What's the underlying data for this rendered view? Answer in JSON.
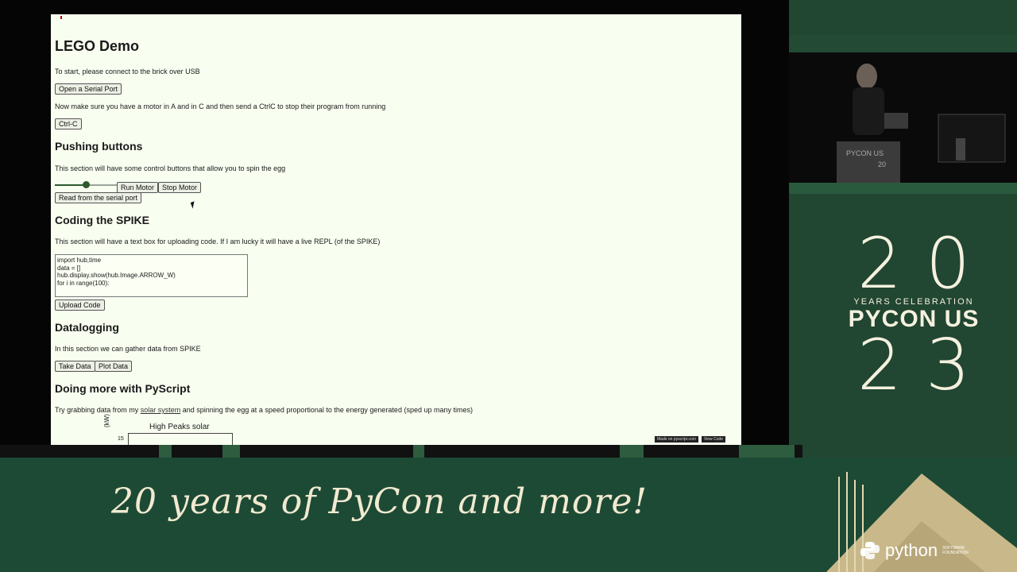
{
  "page": {
    "title": "LEGO Demo",
    "intro": "To start, please connect to the brick over USB",
    "open_serial_label": "Open a Serial Port",
    "motor_instructions": "Now make sure you have a motor in A and in C and then send a CtrlC to stop their program from running",
    "ctrlc_label": "Ctrl-C",
    "buttons_section": {
      "heading": "Pushing buttons",
      "text": "This section will have some control buttons that allow you to spin the egg",
      "slider_value": 0.5,
      "run_motor_label": "Run Motor",
      "stop_motor_label": "Stop Motor",
      "read_serial_label": "Read from the serial port"
    },
    "coding_section": {
      "heading": "Coding the SPIKE",
      "text": "This section will have a text box for uploading code. If I am lucky it will have a live REPL (of the SPIKE)",
      "code_lines": [
        "import hub,time",
        "",
        "data = []",
        "hub.display.show(hub.Image.ARROW_W)",
        "for i in range(100):"
      ],
      "upload_label": "Upload Code"
    },
    "datalogging_section": {
      "heading": "Datalogging",
      "text": "In this section we can gather data from SPIKE",
      "take_data_label": "Take Data",
      "plot_data_label": "Plot Data"
    },
    "pyscript_section": {
      "heading": "Doing more with PyScript",
      "text_before": "Try grabbing data from my ",
      "link_text": "solar system",
      "text_after": " and spinning the egg at a speed proportional to the energy generated (sped up many times)"
    },
    "chart": {
      "title": "High Peaks solar",
      "ylabel": "(kW)",
      "tick": "15"
    },
    "footer": {
      "made_on": "Made on pyscript.com",
      "view_code": "View Code"
    }
  },
  "brand": {
    "digits_top": "20",
    "celebration": "YEARS CELEBRATION",
    "pycon": "PYCON US",
    "digits_bottom": "23",
    "podium_text": "PYCON US",
    "podium_num": "20"
  },
  "tagline": "20 years of PyCon and more!",
  "python_logo": {
    "word": "python",
    "sub": "SOFTWARE FOUNDATION"
  },
  "colors": {
    "background": "#214632",
    "page_bg": "#f8fef0",
    "accent_cream": "#f1ead0"
  },
  "icons": {
    "python": "python-logo-icon",
    "cursor": "mouse-cursor-icon"
  }
}
